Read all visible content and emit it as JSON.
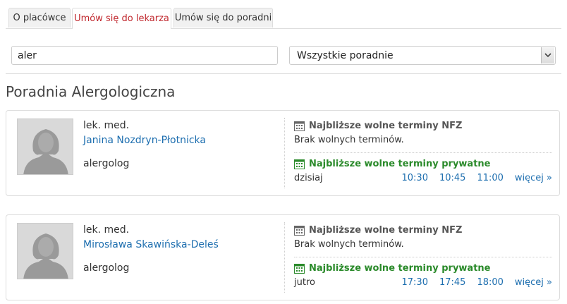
{
  "tabs": [
    {
      "label": "O placówce"
    },
    {
      "label": "Umów się do lekarza"
    },
    {
      "label": "Umów się do poradni"
    }
  ],
  "search": {
    "value": "aler"
  },
  "clinic_select": {
    "selected": "Wszystkie poradnie"
  },
  "section": {
    "title": "Poradnia Alergologiczna"
  },
  "doctors": [
    {
      "title": "lek. med.",
      "name": "Janina Nozdryn-Płotnicka",
      "specialty": "alergolog",
      "nfz_header": "Najbliższe wolne terminy NFZ",
      "nfz_note": "Brak wolnych terminów.",
      "private_header": "Najbliższe wolne terminy prywatne",
      "day": "dzisiaj",
      "times": [
        "10:30",
        "10:45",
        "11:00"
      ],
      "more": "więcej »"
    },
    {
      "title": "lek. med.",
      "name": "Mirosława Skawińska-Deleś",
      "specialty": "alergolog",
      "nfz_header": "Najbliższe wolne terminy NFZ",
      "nfz_note": "Brak wolnych terminów.",
      "private_header": "Najbliższe wolne terminy prywatne",
      "day": "jutro",
      "times": [
        "17:30",
        "17:45",
        "18:00"
      ],
      "more": "więcej »"
    }
  ],
  "colors": {
    "accent_red": "#c0272d",
    "link_blue": "#1d6eaf",
    "private_green": "#2a8a2a"
  }
}
